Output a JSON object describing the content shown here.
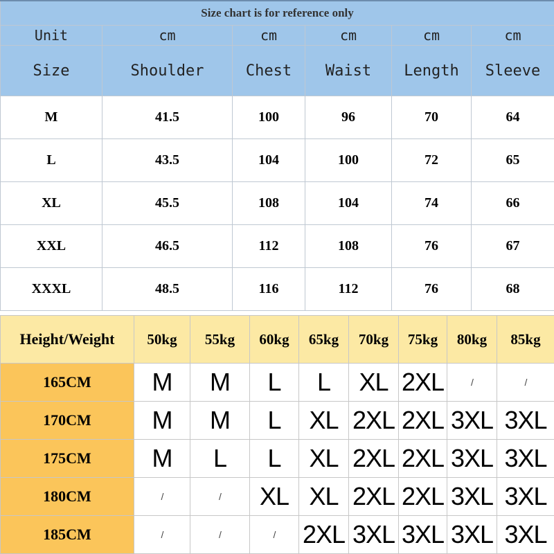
{
  "size_chart": {
    "caption": "Size chart is for reference only",
    "unit_row": [
      "Unit",
      "cm",
      "cm",
      "cm",
      "cm",
      "cm"
    ],
    "header_row": [
      "Size",
      "Shoulder",
      "Chest",
      "Waist",
      "Length",
      "Sleeve"
    ],
    "rows": [
      [
        "M",
        "41.5",
        "100",
        "96",
        "70",
        "64"
      ],
      [
        "L",
        "43.5",
        "104",
        "100",
        "72",
        "65"
      ],
      [
        "XL",
        "45.5",
        "108",
        "104",
        "74",
        "66"
      ],
      [
        "XXL",
        "46.5",
        "112",
        "108",
        "76",
        "67"
      ],
      [
        "XXXL",
        "48.5",
        "116",
        "112",
        "76",
        "68"
      ]
    ]
  },
  "fit_chart": {
    "corner": "Height/Weight",
    "weights": [
      "50kg",
      "55kg",
      "60kg",
      "65kg",
      "70kg",
      "75kg",
      "80kg",
      "85kg"
    ],
    "rows": [
      {
        "height": "165CM",
        "sizes": [
          "M",
          "M",
          "L",
          "L",
          "XL",
          "2XL",
          "/",
          "/"
        ]
      },
      {
        "height": "170CM",
        "sizes": [
          "M",
          "M",
          "L",
          "XL",
          "2XL",
          "2XL",
          "3XL",
          "3XL"
        ]
      },
      {
        "height": "175CM",
        "sizes": [
          "M",
          "L",
          "L",
          "XL",
          "2XL",
          "2XL",
          "3XL",
          "3XL"
        ]
      },
      {
        "height": "180CM",
        "sizes": [
          "/",
          "/",
          "XL",
          "XL",
          "2XL",
          "2XL",
          "3XL",
          "3XL"
        ]
      },
      {
        "height": "185CM",
        "sizes": [
          "/",
          "/",
          "/",
          "2XL",
          "3XL",
          "3XL",
          "3XL",
          "3XL"
        ]
      }
    ]
  },
  "colors": {
    "blue_header": "#9fc6ea",
    "yellow_header": "#fce9a4",
    "orange_height_cells": "#fbc55a"
  }
}
